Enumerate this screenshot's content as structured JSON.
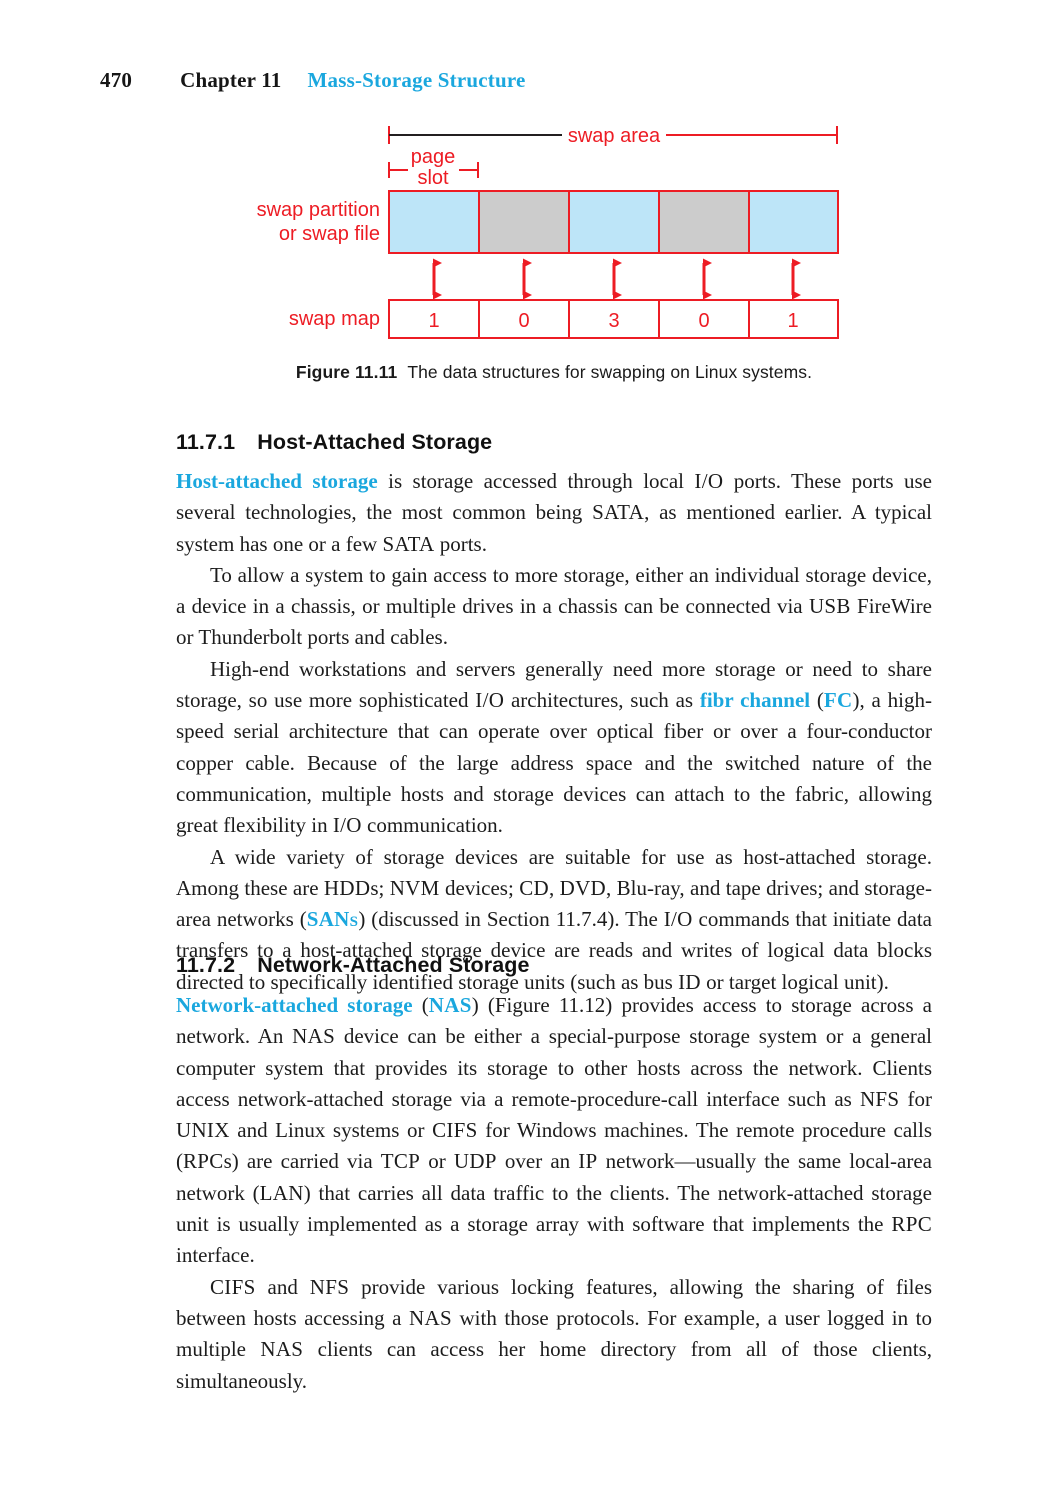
{
  "page": {
    "folio": "470",
    "chapter_label": "Chapter 11",
    "chapter_title": "Mass-Storage Structure"
  },
  "figure": {
    "caption_label": "Figure 11.11",
    "caption_text": "The data structures for swapping on Linux systems.",
    "labels": {
      "swap_area": "swap area",
      "page_slot_line1": "page",
      "page_slot_line2": "slot",
      "partition_line1": "swap partition",
      "partition_line2": "or swap file",
      "swap_map": "swap map"
    },
    "colors": {
      "red": "#ed1c24",
      "blue_fill": "#bde5f8",
      "gray_fill": "#cccccc",
      "black": "#231f20"
    },
    "slot_fills": [
      "blue",
      "gray",
      "blue",
      "gray",
      "blue"
    ],
    "swap_map_values": [
      "1",
      "0",
      "3",
      "0",
      "1"
    ]
  },
  "sections": [
    {
      "number": "11.7.1",
      "title": "Host-Attached Storage"
    },
    {
      "number": "11.7.2",
      "title": "Network-Attached Storage"
    }
  ],
  "paragraphs": {
    "p1": {
      "term": "Host-attached storage",
      "rest_a": " is storage accessed through local ",
      "sc1": "I/O",
      "rest_b": " ports. These ports use several technologies, the most common being ",
      "sc2": "SATA",
      "rest_c": ", as mentioned earlier. A typical system has one or a few ",
      "sc3": "SATA",
      "rest_d": " ports."
    },
    "p2": {
      "a": "To allow a system to gain access to more storage, either an individual storage device, a device in a chassis, or multiple drives in a chassis can be connected via ",
      "sc1": "USB",
      "b": " FireWire or Thunderbolt ports and cables."
    },
    "p3": {
      "a": "High-end workstations and servers generally need more storage or need to share storage, so use more sophisticated ",
      "sc1": "I/O",
      "b": " architectures, such as ",
      "term": "fibr channel",
      "c": " (",
      "acr": "FC",
      "d": "), a high-speed serial architecture that can operate over optical fiber or over a four-conductor copper cable. Because of the large address space and the switched nature of the communication, multiple hosts and storage devices can attach to the fabric, allowing great flexibility in ",
      "sc2": "I/O",
      "e": " communication."
    },
    "p4": {
      "a": "A wide variety of storage devices are suitable for use as host-attached storage. Among these are ",
      "sc1": "HDD",
      "a2": "s; ",
      "sc2": "NVM",
      "b": " devices; ",
      "sc3": "CD",
      "b2": ", ",
      "sc4": "DVD",
      "b3": ", Blu-ray, and tape drives; and storage-area networks (",
      "acr": "SAN",
      "acr_s": "s",
      "c": ") (discussed in Section 11.7.4). The ",
      "sc5": "I/O",
      "d": " commands that initiate data transfers to a host-attached storage device are reads and writes of logical data blocks directed to specifically identified storage units (such as bus ",
      "sc6": "ID",
      "e": " or target logical unit)."
    },
    "p5": {
      "term": "Network-attached storage",
      "a": " (",
      "acr": "NAS",
      "b": ") (Figure 11.12) provides access to storage across a network. An ",
      "sc1": "NAS",
      "c": " device can be either a special-purpose storage system or a general computer system that provides its storage to other hosts across the network. Clients access network-attached storage via a remote-procedure-call interface such as ",
      "sc2": "NFS",
      "d": " for ",
      "sc3": "UNIX",
      "e": " and Linux systems or ",
      "sc4": "CIFS",
      "f": " for Windows machines. The remote procedure calls (",
      "sc5": "RPC",
      "f2": "s) are carried via ",
      "sc6": "TCP",
      "g": " or ",
      "sc7": "UDP",
      "h": " over an ",
      "sc8": "IP",
      "i": " network—usually the same local-area network (",
      "sc9": "LAN",
      "j": ") that carries all data traffic to the clients. The network-attached storage unit is usually implemented as a storage array with software that implements the ",
      "sc10": "RPC",
      "k": " interface."
    },
    "p6": {
      "sc1": "CIFS",
      "a": " and ",
      "sc2": "NFS",
      "b": " provide various locking features, allowing the sharing of files between hosts accessing a ",
      "sc3": "NAS",
      "c": " with those protocols. For example, a user logged in to multiple ",
      "sc4": "NAS",
      "d": " clients can access her home directory from all of those clients, simultaneously."
    }
  }
}
